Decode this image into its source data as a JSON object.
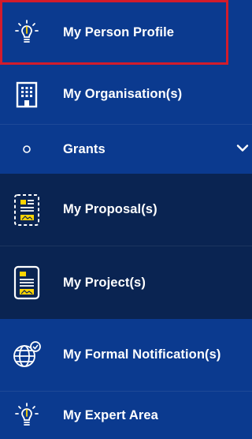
{
  "menu": {
    "items": [
      {
        "label": "My Person Profile",
        "icon": "lightbulb-icon",
        "selected": true
      },
      {
        "label": "My Organisation(s)",
        "icon": "building-icon"
      },
      {
        "label": "Grants",
        "icon": "circle-bullet-icon",
        "expandable": true
      },
      {
        "label": "My Proposal(s)",
        "icon": "proposal-document-icon"
      },
      {
        "label": "My Project(s)",
        "icon": "project-document-icon"
      },
      {
        "label": "My Formal Notification(s)",
        "icon": "globe-notification-icon"
      },
      {
        "label": "My Expert Area",
        "icon": "lightbulb-icon"
      }
    ]
  },
  "colors": {
    "menu_blue": "#0b3a8f",
    "menu_dark": "#0a2452",
    "selected_border": "#d21c2c",
    "icon_yellow": "#ffd400"
  }
}
